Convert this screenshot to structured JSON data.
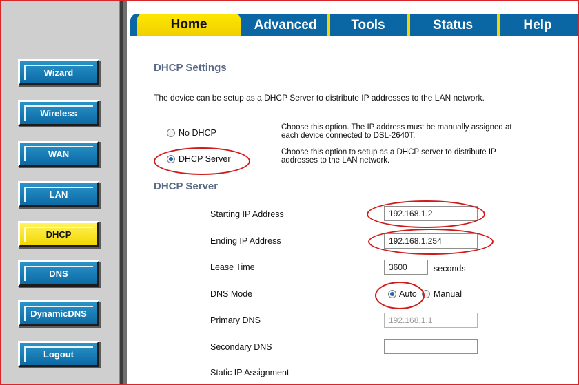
{
  "sidebar": {
    "items": [
      {
        "label": "Wizard"
      },
      {
        "label": "Wireless"
      },
      {
        "label": "WAN"
      },
      {
        "label": "LAN"
      },
      {
        "label": "DHCP",
        "active": true
      },
      {
        "label": "DNS"
      },
      {
        "label": "DynamicDNS"
      },
      {
        "label": "Logout"
      }
    ]
  },
  "tabs": [
    {
      "label": "Home",
      "active": true
    },
    {
      "label": "Advanced"
    },
    {
      "label": "Tools"
    },
    {
      "label": "Status"
    },
    {
      "label": "Help"
    }
  ],
  "dhcp_settings": {
    "title": "DHCP Settings",
    "description": "The device can be setup as a DHCP Server to distribute IP addresses to the LAN network.",
    "options": [
      {
        "label": "No DHCP",
        "selected": false,
        "desc_line1": "Choose this option. The IP address must be manually assigned at",
        "desc_line2": "each device connected to DSL-2640T."
      },
      {
        "label": "DHCP Server",
        "selected": true,
        "desc_line1": "Choose this option to setup as a DHCP server to distribute IP",
        "desc_line2": "addresses to the LAN network."
      }
    ]
  },
  "dhcp_server": {
    "title": "DHCP Server",
    "starting_ip": {
      "label": "Starting IP Address",
      "value": "192.168.1.2"
    },
    "ending_ip": {
      "label": "Ending IP Address",
      "value": "192.168.1.254"
    },
    "lease_time": {
      "label": "Lease Time",
      "value": "3600",
      "unit": "seconds"
    },
    "dns_mode": {
      "label": "DNS Mode",
      "options": [
        {
          "label": "Auto",
          "selected": true
        },
        {
          "label": "Manual",
          "selected": false
        }
      ]
    },
    "primary_dns": {
      "label": "Primary DNS",
      "value": "192.168.1.1"
    },
    "secondary_dns": {
      "label": "Secondary DNS",
      "value": ""
    },
    "static_ip": {
      "label": "Static IP Assignment"
    }
  },
  "colors": {
    "nav_blue": "#0c6aa5",
    "nav_active_yellow": "#f2d600",
    "heading": "#5b6a86",
    "annotation_red": "#d11a1a",
    "frame_red": "#d9262b"
  }
}
